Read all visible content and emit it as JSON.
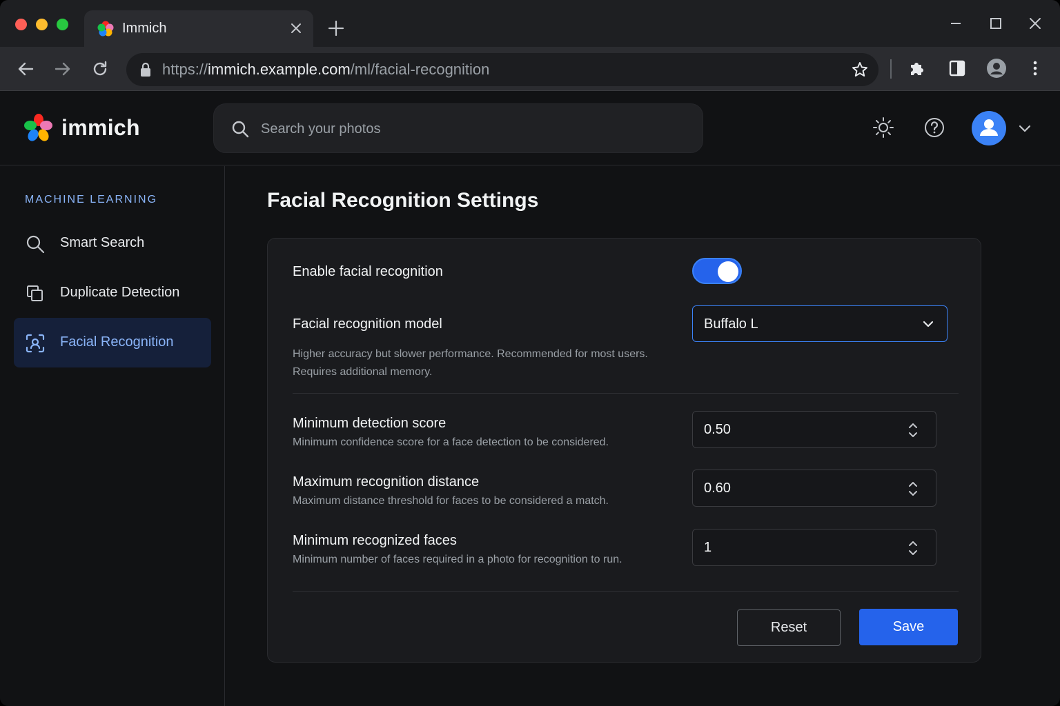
{
  "browser": {
    "tab_title": "Immich",
    "url_prefix": "https://",
    "url_host": "immich.example.com",
    "url_path": "/ml/facial-recognition"
  },
  "header": {
    "brand": "immich",
    "search_placeholder": "Search your photos"
  },
  "sidebar": {
    "heading": "MACHINE LEARNING",
    "items": [
      {
        "label": "Smart Search",
        "icon": "search-icon",
        "active": false
      },
      {
        "label": "Duplicate Detection",
        "icon": "duplicate-icon",
        "active": false
      },
      {
        "label": "Facial Recognition",
        "icon": "face-scan-icon",
        "active": true
      }
    ]
  },
  "main": {
    "title": "Facial Recognition Settings",
    "enable": {
      "label": "Enable facial recognition",
      "value": true
    },
    "model": {
      "label": "Facial recognition model",
      "value": "Buffalo L",
      "desc_line1": "Higher accuracy but slower performance. Recommended for most users.",
      "desc_line2": "Requires additional memory."
    },
    "min_score": {
      "label": "Minimum detection score",
      "desc": "Minimum confidence score for a face detection to be considered.",
      "value": "0.50"
    },
    "max_distance": {
      "label": "Maximum recognition distance",
      "desc": "Maximum distance threshold for faces to be considered a match.",
      "value": "0.60"
    },
    "min_faces": {
      "label": "Minimum recognized faces",
      "desc": "Minimum number of faces required in a photo for recognition to run.",
      "value": "1"
    },
    "reset_label": "Reset",
    "save_label": "Save"
  },
  "colors": {
    "accent": "#2563eb",
    "accent_light": "#8ab4f8",
    "background": "#111214",
    "card": "#1a1b1e"
  }
}
